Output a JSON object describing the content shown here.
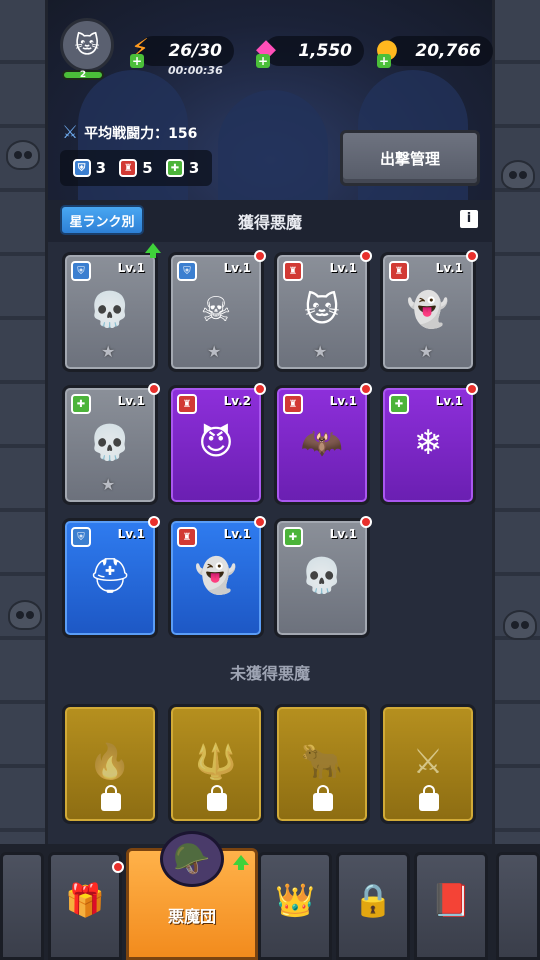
{
  "header": {
    "avatar_level": "2",
    "energy": "26/30",
    "energy_timer": "00:00:36",
    "gems": "1,550",
    "gold": "20,766"
  },
  "power": {
    "label": "平均戦闘力：156",
    "counts": {
      "shield": "3",
      "attack": "5",
      "support": "3"
    },
    "deploy_button": "出撃管理"
  },
  "owned_section": {
    "sort_button": "星ランク別",
    "title": "獲得悪魔",
    "info_icon": "i"
  },
  "owned_cards": [
    {
      "type": "shield",
      "rarity": "gray",
      "level": "Lv.1",
      "icon": "skull-pair-icon",
      "star": "★",
      "upgrade": true,
      "dot": false
    },
    {
      "type": "shield",
      "rarity": "gray",
      "level": "Lv.1",
      "icon": "spear-skull-icon",
      "star": "★",
      "upgrade": false,
      "dot": true
    },
    {
      "type": "attack",
      "rarity": "gray",
      "level": "Lv.1",
      "icon": "cat-quartet-icon",
      "star": "★",
      "upgrade": false,
      "dot": true
    },
    {
      "type": "attack",
      "rarity": "gray",
      "level": "Lv.1",
      "icon": "hooded-trio-icon",
      "star": "★",
      "upgrade": false,
      "dot": true
    },
    {
      "type": "support",
      "rarity": "gray",
      "level": "Lv.1",
      "icon": "hooded-skull-icon",
      "star": "★",
      "upgrade": false,
      "dot": true
    },
    {
      "type": "attack",
      "rarity": "purple",
      "level": "Lv.2",
      "icon": "red-bomb-icon",
      "star": "",
      "upgrade": false,
      "dot": true
    },
    {
      "type": "attack",
      "rarity": "purple",
      "level": "Lv.1",
      "icon": "blue-ninja-icon",
      "star": "",
      "upgrade": false,
      "dot": true
    },
    {
      "type": "support",
      "rarity": "purple",
      "level": "Lv.1",
      "icon": "ice-crystal-icon",
      "star": "",
      "upgrade": false,
      "dot": true
    },
    {
      "type": "shield",
      "rarity": "blue",
      "level": "Lv.1",
      "icon": "horned-helmet-icon",
      "star": "",
      "upgrade": false,
      "dot": true
    },
    {
      "type": "attack",
      "rarity": "blue",
      "level": "Lv.1",
      "icon": "ghost-boat-icon",
      "star": "",
      "upgrade": false,
      "dot": true
    },
    {
      "type": "support",
      "rarity": "gray",
      "level": "Lv.1",
      "icon": "trumpet-skull-icon",
      "star": "",
      "upgrade": false,
      "dot": true
    }
  ],
  "unowned_section": {
    "title": "未獲得悪魔"
  },
  "unowned_cards": [
    {
      "icon": "flame-knight-icon"
    },
    {
      "icon": "trident-mage-icon"
    },
    {
      "icon": "horned-beast-icon"
    },
    {
      "icon": "scythe-warrior-icon"
    }
  ],
  "bottom_nav": [
    {
      "icon": "treasure-chest-icon",
      "label": "",
      "dot": true
    },
    {
      "icon": "knight-helmet-icon",
      "label": "悪魔団",
      "active": true,
      "upgrade": true
    },
    {
      "icon": "crown-icon",
      "label": ""
    },
    {
      "icon": "locked-portal-icon",
      "label": ""
    },
    {
      "icon": "spellbook-icon",
      "label": ""
    }
  ],
  "colors": {
    "shield": "#3c7fd0",
    "attack": "#d23a34",
    "support": "#4cb43a",
    "active_tab": "#f28b1d"
  }
}
